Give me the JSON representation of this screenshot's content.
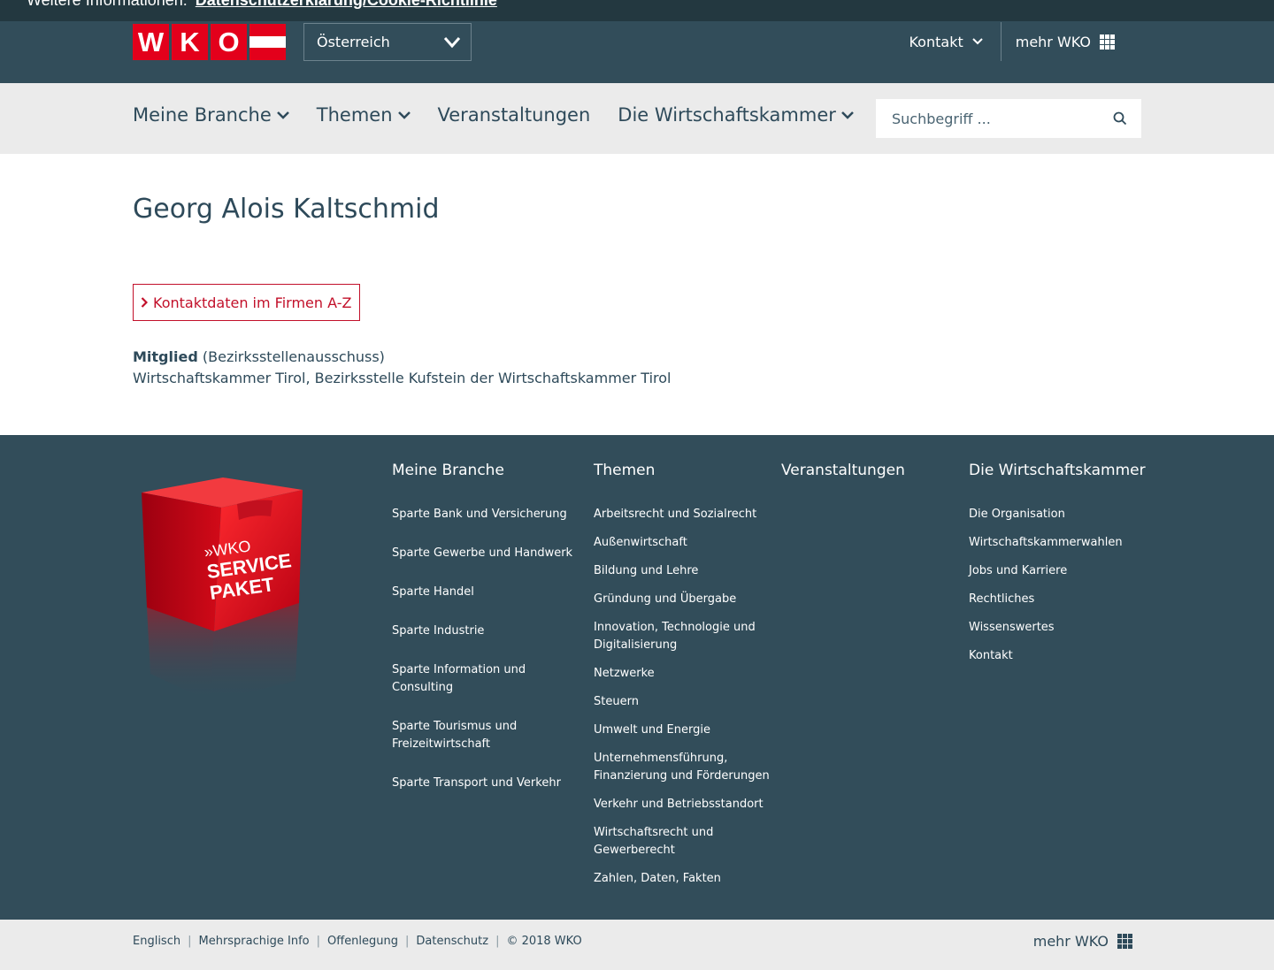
{
  "cookie": {
    "text": "Weitere Informationen:",
    "link": "Datenschutzerklärung/Cookie-Richtlinie"
  },
  "header": {
    "logo_letters": [
      "W",
      "K",
      "O"
    ],
    "region": "Österreich",
    "contact_label": "Kontakt",
    "more_label": "mehr WKO"
  },
  "nav": {
    "items": [
      {
        "label": "Meine Branche",
        "dropdown": true
      },
      {
        "label": "Themen",
        "dropdown": true
      },
      {
        "label": "Veranstaltungen",
        "dropdown": false
      },
      {
        "label": "Die Wirtschaftskammer",
        "dropdown": true
      }
    ],
    "search_placeholder": "Suchbegriff ..."
  },
  "main": {
    "title": "Georg Alois Kaltschmid",
    "contact_button": "Kontaktdaten im Firmen A-Z",
    "member_label": "Mitglied",
    "member_role": "(Bezirksstellenausschuss)",
    "member_org": "Wirtschaftskammer Tirol, Bezirksstelle Kufstein der Wirtschaftskammer Tirol"
  },
  "footer": {
    "service_box": {
      "prefix": "»WKO",
      "line1": "SERVICE",
      "line2": "PAKET"
    },
    "branche": {
      "title": "Meine Branche",
      "items": [
        "Sparte Bank und Versicherung",
        "Sparte Gewerbe und Handwerk",
        "Sparte Handel",
        "Sparte Industrie",
        "Sparte Information und Consulting",
        "Sparte Tourismus und Freizeitwirtschaft",
        "Sparte Transport und Verkehr"
      ]
    },
    "themen": {
      "title": "Themen",
      "items": [
        "Arbeitsrecht und Sozialrecht",
        "Außenwirtschaft",
        "Bildung und Lehre",
        "Gründung und Übergabe",
        "Innovation, Technologie und Digitalisierung",
        "Netzwerke",
        "Steuern",
        "Umwelt und Energie",
        "Unternehmensführung, Finanzierung und Förderungen",
        "Verkehr und Betriebsstandort",
        "Wirtschaftsrecht und Gewerberecht",
        "Zahlen, Daten, Fakten"
      ]
    },
    "veranstaltungen": {
      "title": "Veranstaltungen"
    },
    "wirtschaftskammer": {
      "title": "Die Wirtschaftskammer",
      "items": [
        "Die Organisation",
        "Wirtschaftskammerwahlen",
        "Jobs und Karriere",
        "Rechtliches",
        "Wissenswertes",
        "Kontakt"
      ]
    }
  },
  "bottom": {
    "links": [
      "Englisch",
      "Mehrsprachige Info",
      "Offenlegung",
      "Datenschutz"
    ],
    "copyright": "© 2018 WKO",
    "more_label": "mehr WKO"
  },
  "colors": {
    "brand_red": "#e3001b",
    "dark_teal": "#324d5a",
    "nav_bg": "#ebebeb",
    "link_red": "#c2102a"
  }
}
